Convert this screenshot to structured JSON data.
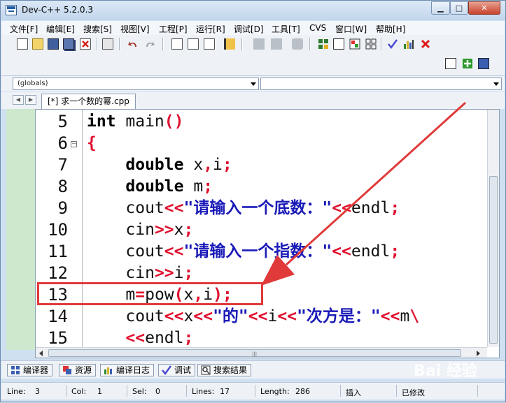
{
  "window": {
    "title": "Dev-C++ 5.2.0.3",
    "minimize": "▁",
    "maximize": "□",
    "close": "✕"
  },
  "menu": [
    "文件[F]",
    "编辑[E]",
    "搜索[S]",
    "视图[V]",
    "工程[P]",
    "运行[R]",
    "调试[D]",
    "工具[T]",
    "CVS",
    "窗口[W]",
    "帮助[H]"
  ],
  "toolbar": {
    "icons": [
      "new-file-icon",
      "open-file-icon",
      "save-icon",
      "save-all-icon",
      "close-file-icon",
      "print-icon",
      "undo-icon",
      "redo-icon",
      "find-icon",
      "replace-icon",
      "find-next-icon",
      "goto-line-icon",
      "compile-icon",
      "run-icon",
      "compile-run-icon",
      "rebuild-icon",
      "new-project-icon",
      "insert-icon",
      "toggle-bookmark-icon",
      "goto-bookmark-icon",
      "check-syntax-icon",
      "chart-icon",
      "stop-icon",
      "add-file-icon",
      "add-to-project-icon",
      "project-options-icon"
    ]
  },
  "scope_combo": {
    "value": "(globals)"
  },
  "symbol_combo": {
    "value": ""
  },
  "file_tab": {
    "label": "[*] 求一个数的幂.cpp"
  },
  "editor": {
    "lines": [
      {
        "num": "5",
        "text": "int main()"
      },
      {
        "num": "6",
        "text": "{"
      },
      {
        "num": "7",
        "text": "    double x,i;"
      },
      {
        "num": "8",
        "text": "    double m;"
      },
      {
        "num": "9",
        "text": "    cout<<\"请输入一个底数：\"<<endl;"
      },
      {
        "num": "10",
        "text": "    cin>>x;"
      },
      {
        "num": "11",
        "text": "    cout<<\"请输入一个指数：\"<<endl;"
      },
      {
        "num": "12",
        "text": "    cin>>i;"
      },
      {
        "num": "13",
        "text": "    m=pow(x,i);"
      },
      {
        "num": "14",
        "text": "    cout<<x<<\"的\"<<i<<\"次方是：\"<<m\\"
      },
      {
        "num": "15",
        "text": "    <<endl;"
      }
    ],
    "fold_marker": "−"
  },
  "bottom_tabs": [
    "编译器",
    "资源",
    "编译日志",
    "调试",
    "搜索结果"
  ],
  "status": {
    "line_label": "Line:",
    "line_value": "3",
    "col_label": "Col:",
    "col_value": "1",
    "sel_label": "Sel:",
    "sel_value": "0",
    "lines_label": "Lines:",
    "lines_value": "17",
    "length_label": "Length:",
    "length_value": "286",
    "mode": "插入",
    "modified": "已修改"
  },
  "watermark": "Bai 经验",
  "colors": {
    "keyword": "#000000",
    "operator": "#e0102e",
    "string": "#1a1ab8",
    "annotation": "#e03a3a",
    "left_pane": "#cde8cd"
  }
}
